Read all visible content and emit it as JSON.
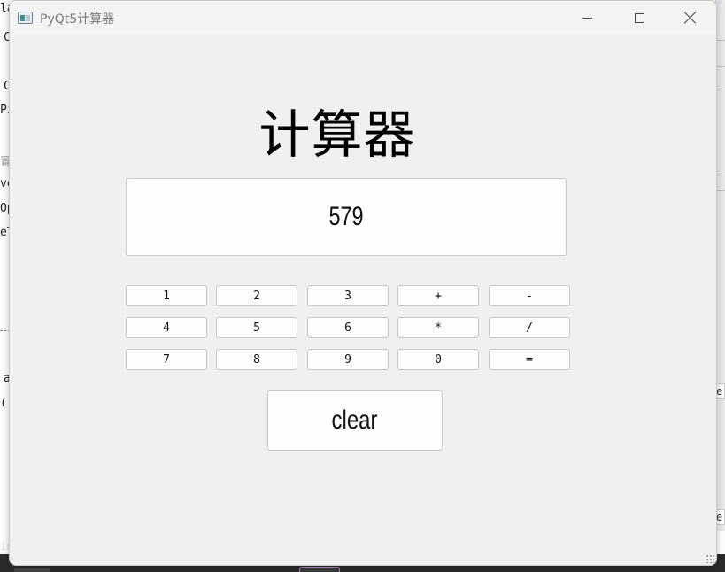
{
  "background": {
    "left_fragments": [
      "la",
      "C",
      "C",
      "Pi",
      "置/",
      "ve",
      "Op",
      "eT",
      "a",
      "()"
    ],
    "right_fragments": [
      "e",
      "e"
    ],
    "bottom_fragment": "in"
  },
  "window": {
    "title": "PyQt5计算器",
    "icon": "app-icon",
    "controls": {
      "minimize": "minimize-icon",
      "maximize": "maximize-icon",
      "close": "close-icon"
    }
  },
  "calculator": {
    "heading": "计算器",
    "display_value": "579",
    "keys": [
      [
        "1",
        "2",
        "3",
        "+",
        "-"
      ],
      [
        "4",
        "5",
        "6",
        "*",
        "/"
      ],
      [
        "7",
        "8",
        "9",
        "0",
        "="
      ]
    ],
    "clear_label": "clear"
  }
}
